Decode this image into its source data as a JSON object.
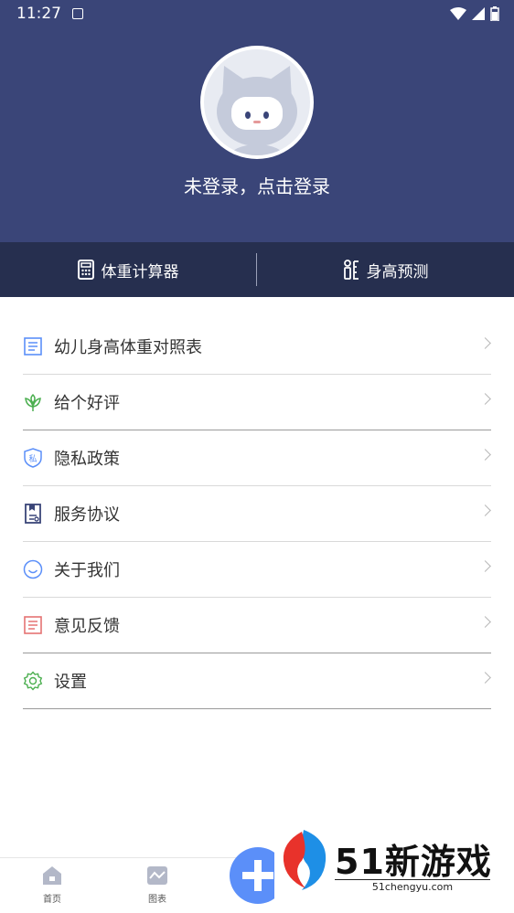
{
  "status_bar": {
    "time": "11:27"
  },
  "profile": {
    "login_prompt": "未登录，点击登录"
  },
  "tools": {
    "left_label": "体重计算器",
    "right_label": "身高预测"
  },
  "menu": {
    "items": [
      {
        "label": "幼儿身高体重对照表",
        "icon": "table-icon",
        "icon_color": "#5b8ff9"
      },
      {
        "label": "给个好评",
        "icon": "flower-icon",
        "icon_color": "#4caf50"
      },
      {
        "label": "隐私政策",
        "icon": "privacy-shield-icon",
        "icon_color": "#5b8ff9",
        "icon_text": "私"
      },
      {
        "label": "服务协议",
        "icon": "agreement-icon",
        "icon_color": "#3a4578"
      },
      {
        "label": "关于我们",
        "icon": "smile-icon",
        "icon_color": "#5b8ff9"
      },
      {
        "label": "意见反馈",
        "icon": "feedback-icon",
        "icon_color": "#e57373"
      },
      {
        "label": "设置",
        "icon": "gear-icon",
        "icon_color": "#4caf50"
      }
    ]
  },
  "bottom_nav": {
    "home_label": "首页",
    "chart_label": "图表"
  },
  "watermark": {
    "brand": "51新游戏",
    "url": "51chengyu.com"
  },
  "colors": {
    "header": "#3a4578",
    "toolbar": "#262f4f",
    "accent": "#5b8ff9"
  }
}
